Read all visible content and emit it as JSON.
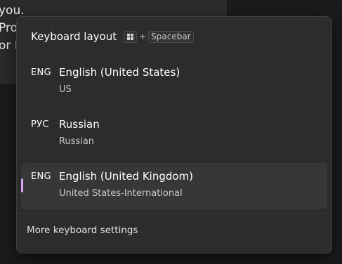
{
  "background_window": {
    "lines": [
      "you.",
      "Prov",
      "or N"
    ]
  },
  "flyout": {
    "title": "Keyboard layout",
    "shortcut": {
      "modifier_icon": "windows-logo-icon",
      "plus": "+",
      "key": "Spacebar"
    },
    "layouts": [
      {
        "code": "ENG",
        "name": "English (United States)",
        "keyboard": "US",
        "selected": false
      },
      {
        "code": "РУС",
        "name": "Russian",
        "keyboard": "Russian",
        "selected": false
      },
      {
        "code": "ENG",
        "name": "English (United Kingdom)",
        "keyboard": "United States-International",
        "selected": true
      }
    ],
    "more_settings": "More keyboard settings"
  },
  "colors": {
    "selection_indicator": "#d6a7f0",
    "flyout_background": "#2c2c2c",
    "selected_row_background": "#373737"
  }
}
